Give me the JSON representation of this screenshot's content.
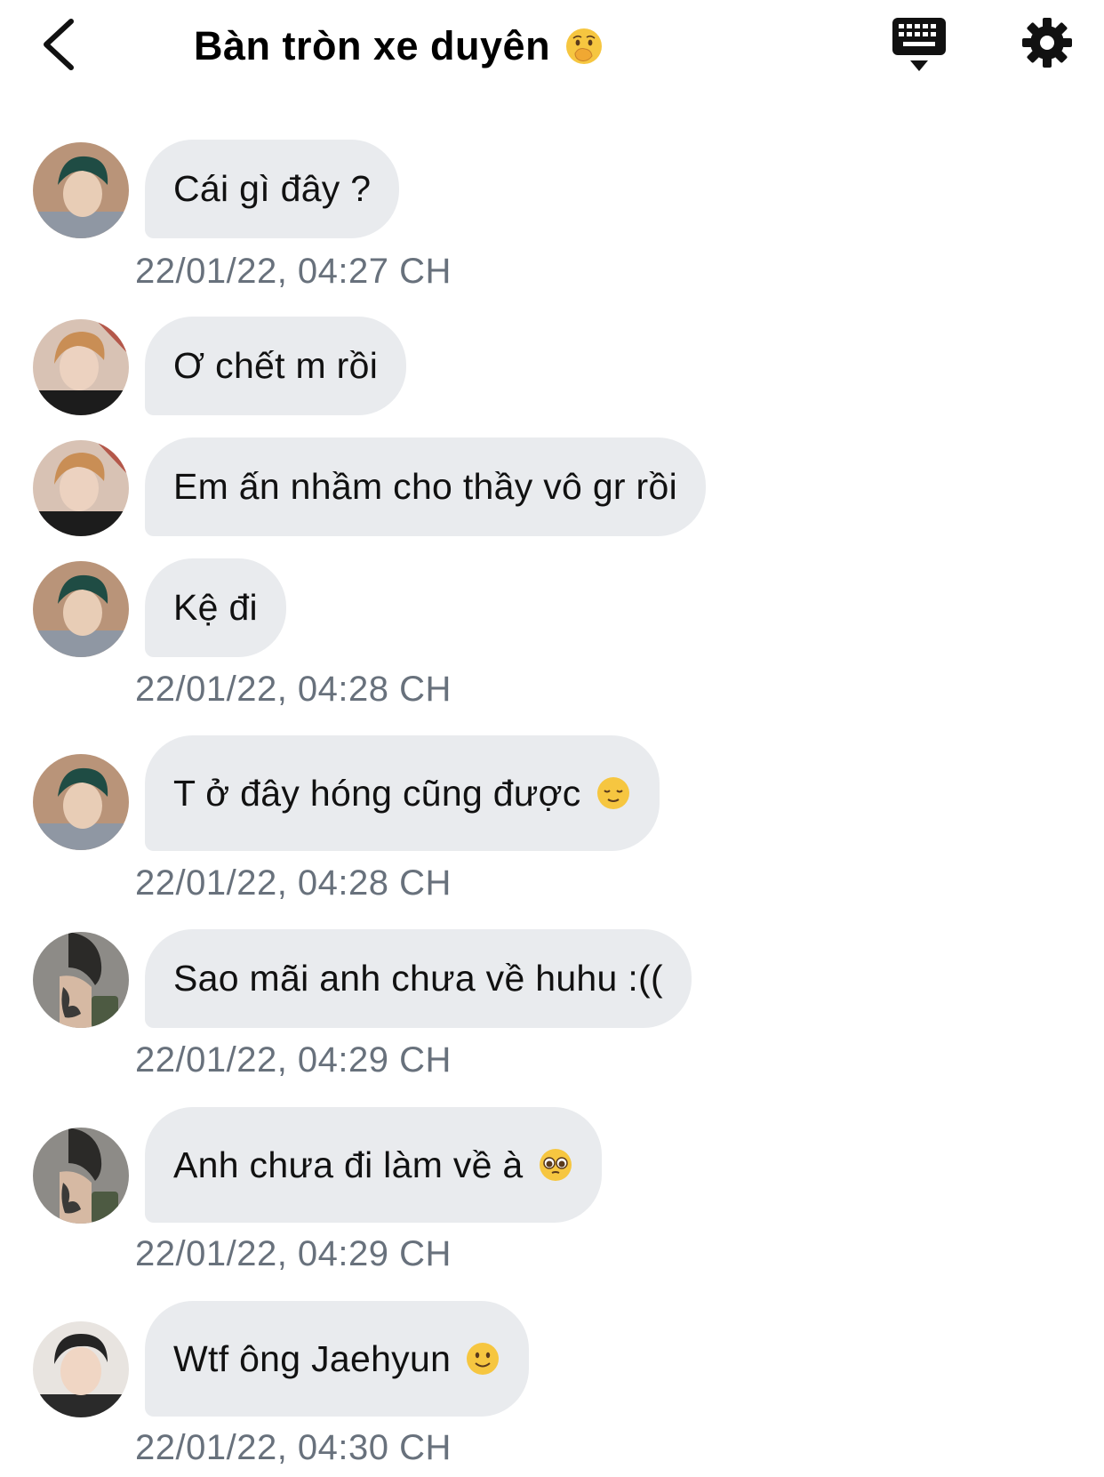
{
  "header": {
    "title": "Bàn tròn xe duyên",
    "title_emoji": "face-with-hand-over-mouth",
    "back_icon": "chevron-left-icon",
    "keyboard_icon": "keyboard-icon",
    "settings_icon": "gear-icon"
  },
  "colors": {
    "bubble": "#e9ebee",
    "timestamp": "#68717c",
    "text": "#111111"
  },
  "messages": [
    {
      "avatar": "avatar-teal-hair",
      "text": "Cái gì đây ?",
      "emoji": "",
      "timestamp": "22/01/22, 04:27 CH"
    },
    {
      "avatar": "avatar-blond-hair",
      "text": "Ơ chết m rồi",
      "emoji": "",
      "timestamp": ""
    },
    {
      "avatar": "avatar-blond-hair",
      "text": "Em ấn nhầm cho thầy vô gr rồi",
      "emoji": "",
      "timestamp": ""
    },
    {
      "avatar": "avatar-teal-hair",
      "text": "Kệ đi",
      "emoji": "",
      "timestamp": "22/01/22, 04:28 CH"
    },
    {
      "avatar": "avatar-teal-hair",
      "text": "T ở đây hóng cũng được",
      "emoji": "relieved-face",
      "timestamp": "22/01/22, 04:28 CH"
    },
    {
      "avatar": "avatar-tattoo",
      "text": "Sao mãi anh chưa về huhu :((",
      "emoji": "",
      "timestamp": "22/01/22, 04:29 CH"
    },
    {
      "avatar": "avatar-tattoo",
      "text": "Anh chưa đi làm về à",
      "emoji": "pleading-face",
      "timestamp": "22/01/22, 04:29 CH"
    },
    {
      "avatar": "avatar-dark-hair",
      "text": "Wtf ông Jaehyun",
      "emoji": "slightly-smiling-face",
      "timestamp": "22/01/22, 04:30 CH"
    }
  ]
}
